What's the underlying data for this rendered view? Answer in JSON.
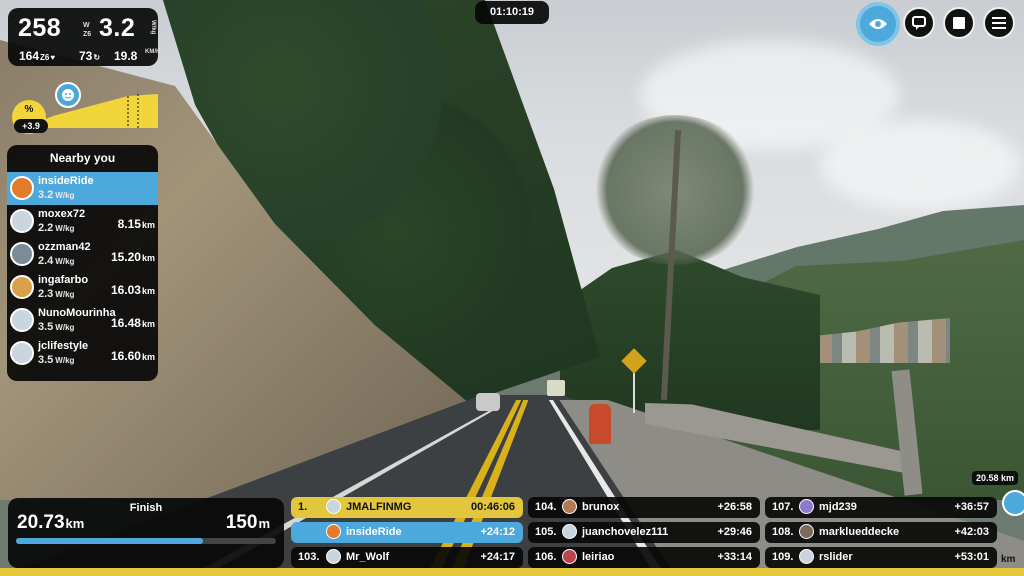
{
  "clock": "01:10:19",
  "stats": {
    "power": "258",
    "power_unit_top": "W",
    "power_unit_bottom": "Z6",
    "wkg": "3.2",
    "wkg_unit": "W/kg",
    "heart_rate": "164",
    "heart_zone": "Z6",
    "cadence": "73",
    "speed": "19.8",
    "speed_unit": "KM/H"
  },
  "elevation": {
    "grade_symbol": "%",
    "grade_value": "+3.9"
  },
  "nearby": {
    "title": "Nearby you",
    "wkg_unit": "W/kg",
    "dist_unit": "km",
    "riders": [
      {
        "name": "insideRide",
        "wkg": "3.2",
        "dist": "",
        "is_me": true
      },
      {
        "name": "moxex72",
        "wkg": "2.2",
        "dist": "8.15"
      },
      {
        "name": "ozzman42",
        "wkg": "2.4",
        "dist": "15.20"
      },
      {
        "name": "ingafarbo",
        "wkg": "2.3",
        "dist": "16.03"
      },
      {
        "name": "NunoMourinha",
        "wkg": "3.5",
        "dist": "16.48"
      },
      {
        "name": "jclifestyle",
        "wkg": "3.5",
        "dist": "16.60"
      }
    ]
  },
  "finish": {
    "label": "Finish",
    "distance": "20.73",
    "distance_unit": "km",
    "elevation": "150",
    "elevation_unit": "m",
    "progress": 0.72
  },
  "leaderboard": [
    {
      "rank": "1.",
      "name": "JMALFINMG",
      "gap": "00:46:06",
      "style": "gold"
    },
    {
      "rank": "",
      "name": "insideRide",
      "gap": "+24:12",
      "style": "me"
    },
    {
      "rank": "103.",
      "name": "Mr_Wolf",
      "gap": "+24:17",
      "style": ""
    },
    {
      "rank": "104.",
      "name": "brunox",
      "gap": "+26:58",
      "style": ""
    },
    {
      "rank": "105.",
      "name": "juanchovelez111",
      "gap": "+29:46",
      "style": ""
    },
    {
      "rank": "106.",
      "name": "leiriao",
      "gap": "+33:14",
      "style": ""
    },
    {
      "rank": "107.",
      "name": "mjd239",
      "gap": "+36:57",
      "style": ""
    },
    {
      "rank": "108.",
      "name": "marklueddecke",
      "gap": "+42:03",
      "style": ""
    },
    {
      "rank": "109.",
      "name": "rslider",
      "gap": "+53:01",
      "style": ""
    }
  ],
  "minimap": {
    "distance": "20.58 km",
    "unit": "km"
  },
  "controls": [
    "eye-icon",
    "chat-icon",
    "stop-icon",
    "menu-icon"
  ],
  "colors": {
    "accent": "#4da8dc",
    "gold": "#e2c63b",
    "panel": "#080808"
  }
}
